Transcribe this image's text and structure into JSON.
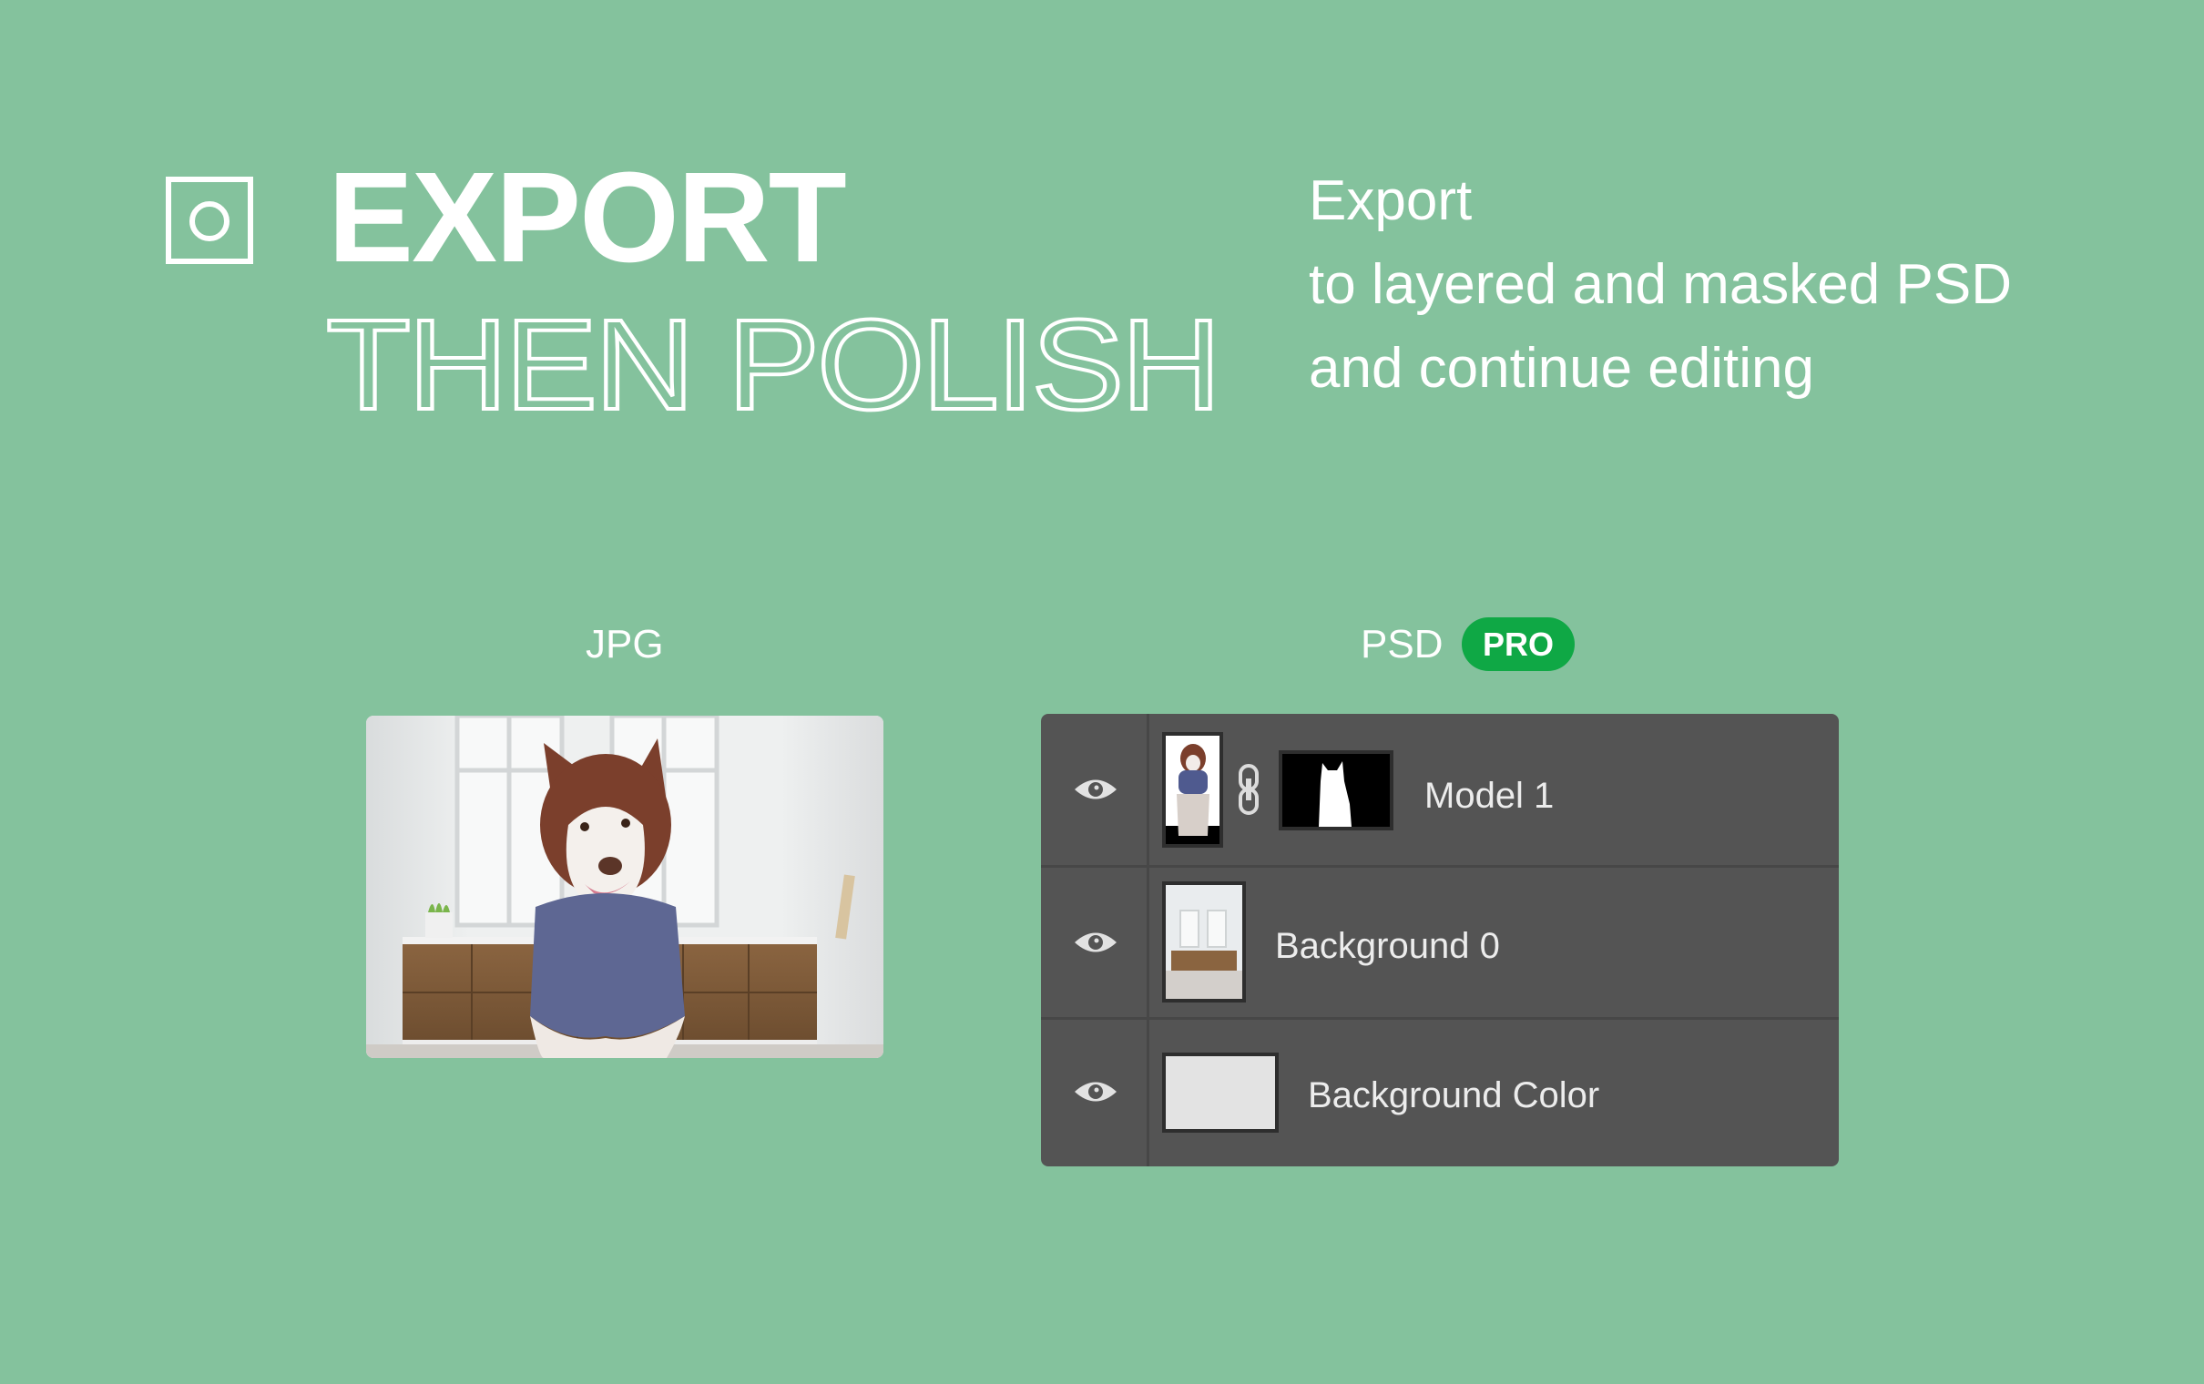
{
  "headline": {
    "line1": "EXPORT",
    "line2": "THEN POLISH"
  },
  "description": {
    "lines": [
      "Export",
      "to layered and masked PSD",
      "and continue editing"
    ]
  },
  "jpg_column": {
    "label": "JPG",
    "image": "husky-in-scarf-kitchen-photo"
  },
  "psd_column": {
    "label": "PSD",
    "badge": "PRO",
    "badge_color": "#0fa845"
  },
  "layers": [
    {
      "name": "Model 1",
      "visible": true,
      "has_mask": true,
      "thumbnail": "husky-cutout",
      "mask": "husky-silhouette-mask"
    },
    {
      "name": "Background 0",
      "visible": true,
      "has_mask": false,
      "thumbnail": "kitchen-background"
    },
    {
      "name": "Background Color",
      "visible": true,
      "has_mask": false,
      "thumbnail": "light-gray-fill"
    }
  ],
  "colors": {
    "page_background": "#84c29d",
    "panel_background": "#545454",
    "background_color_fill": "#e3e3e3"
  }
}
